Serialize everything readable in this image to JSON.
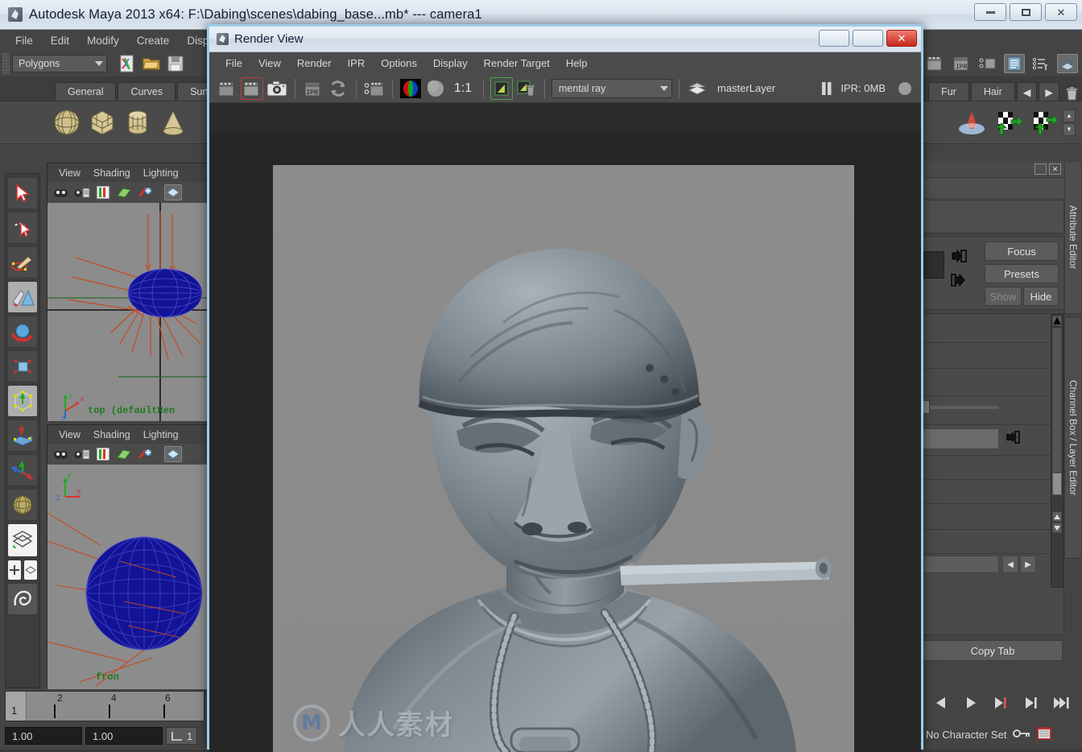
{
  "app": {
    "title": "Autodesk Maya 2013 x64: F:\\Dabing\\scenes\\dabing_base...mb*   ---   camera1",
    "window_buttons": {
      "minimize": "—",
      "maximize": "❐",
      "close": "✕"
    }
  },
  "menubar": {
    "items": [
      "File",
      "Edit",
      "Modify",
      "Create",
      "Displ"
    ]
  },
  "statusline": {
    "mode_selector": "Polygons",
    "icons": [
      "script-editor-icon",
      "open-scene-icon",
      "save-scene-icon"
    ]
  },
  "shelf": {
    "tabs_left": [
      "General",
      "Curves",
      "Surfa"
    ],
    "tabs_right": [
      "Fur",
      "Hair"
    ],
    "nav_prev": "◀",
    "nav_next": "▶",
    "trash": "trash-icon",
    "icons_left": [
      "sphere-icon",
      "cube-icon",
      "cylinder-icon",
      "cone-icon"
    ],
    "icons_right": [
      "fur-feedback-icon",
      "checker-arrow-icon",
      "checker-arrow2-icon"
    ],
    "scroll_up": "▲",
    "scroll_down": "▼"
  },
  "toolbox": {
    "items": [
      {
        "name": "select-tool",
        "icon": "arrow-cursor-icon",
        "selected": false
      },
      {
        "name": "lasso-tool",
        "icon": "lasso-cursor-icon",
        "selected": false
      },
      {
        "name": "paint-select-tool",
        "icon": "paint-brush-icon",
        "selected": false
      },
      {
        "name": "move-tool",
        "icon": "move-arrows-icon",
        "selected": true
      },
      {
        "name": "rotate-tool",
        "icon": "rotate-sphere-icon",
        "selected": false
      },
      {
        "name": "scale-tool",
        "icon": "scale-cube-icon",
        "selected": false
      },
      {
        "name": "universal-manip-tool",
        "icon": "universal-manipulator-icon",
        "selected": true
      },
      {
        "name": "soft-mod-tool",
        "icon": "soft-modification-icon",
        "selected": false
      },
      {
        "name": "last-tool",
        "icon": "axis-arrows-icon",
        "selected": false
      },
      {
        "name": "show-manip-tool",
        "icon": "globe-wire-icon",
        "selected": false
      },
      {
        "name": "single-perspective-layout",
        "icon": "single-view-icon",
        "selected": true
      },
      {
        "name": "four-view-layout",
        "icon": "four-view-icon",
        "selected": false
      },
      {
        "name": "persp-outliner-layout",
        "icon": "outliner-view-icon",
        "selected": false
      },
      {
        "name": "hotbox-tool",
        "icon": "maya-logo-icon",
        "selected": false
      }
    ]
  },
  "viewports": [
    {
      "name": "top-viewport",
      "menus": [
        "View",
        "Shading",
        "Lighting"
      ],
      "label": "top (defaultRen"
    },
    {
      "name": "front-viewport",
      "menus": [
        "View",
        "Shading",
        "Lighting"
      ],
      "label": "fron"
    }
  ],
  "timeline": {
    "current_frame": "1",
    "ticks": [
      "2",
      "4",
      "6"
    ],
    "range_start": "1.00",
    "range_end": "1.00",
    "end_field": "1"
  },
  "attribute_editor": {
    "close_icon": "close-icon",
    "restore_icon": "restore-icon",
    "buttons": {
      "focus": "Focus",
      "presets": "Presets",
      "show": "Show",
      "hide": "Hide"
    },
    "copy_tab": "Copy Tab",
    "vertical_tabs": [
      "Attribute Editor",
      "Channel Box / Layer Editor"
    ],
    "scroll_arrows": {
      "up": "▲",
      "down": "▼",
      "left": "◀",
      "right": "▶"
    }
  },
  "playback": {
    "buttons": [
      {
        "name": "step-back-button",
        "glyph": "◀"
      },
      {
        "name": "play-forward-button",
        "glyph": "▶"
      },
      {
        "name": "step-forward-key-button",
        "glyph": "▶|"
      },
      {
        "name": "go-to-end-key-button",
        "glyph": "▶|"
      },
      {
        "name": "go-to-end-button",
        "glyph": "▶▶|"
      }
    ],
    "character_set": "No Character Set",
    "key_icon": "key-icon",
    "auto-key_icon": "autokey-icon"
  },
  "render_view": {
    "title": "Render View",
    "window_buttons": {
      "minimize": "—",
      "maximize": "❐",
      "close": "✕"
    },
    "menus": [
      "File",
      "View",
      "Render",
      "IPR",
      "Options",
      "Display",
      "Render Target",
      "Help"
    ],
    "toolbar": {
      "icons": [
        {
          "name": "render-region-icon",
          "active": false
        },
        {
          "name": "render-current-frame-icon",
          "active": true
        },
        {
          "name": "snapshot-icon",
          "active": false
        },
        {
          "name": "ipr-render-icon",
          "active": false
        },
        {
          "name": "refresh-render-icon",
          "active": false
        },
        {
          "name": "render-settings-icon",
          "active": false
        },
        {
          "name": "rgb-channels-icon",
          "active": false
        },
        {
          "name": "alpha-channel-icon",
          "active": false
        }
      ],
      "ratio_label": "1:1",
      "keep-image-icon": "keep-image-icon",
      "remove-image-icon": "remove-image-icon",
      "renderer": "mental ray",
      "render_layer": "masterLayer",
      "pause_icon": "pause-icon",
      "ipr_memory": "IPR: 0MB",
      "status_led": "status-led-icon"
    },
    "watermark": {
      "logo": "M",
      "text": "人人素材"
    }
  }
}
